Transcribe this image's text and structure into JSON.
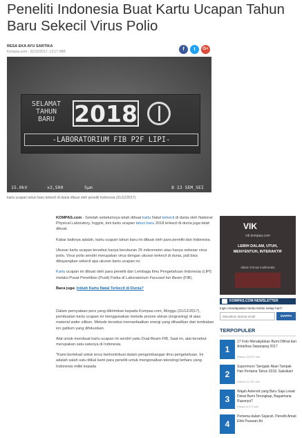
{
  "article": {
    "title": "Peneliti Indonesia Buat Kartu Ucapan Tahun Baru Sekecil Virus Polio",
    "author": "RESA EKA AYU SARTIKA",
    "dateline": "Kompas.com - 31/12/2017, 13:17 WIB",
    "share": {
      "facebook": "f",
      "twitter": "t",
      "googleplus": "G+"
    },
    "photo": {
      "chip_selamat": "SELAMAT\nTAHUN\nBARU",
      "chip_year": "2018",
      "chip_lab": "-LABORATORIUM FIB P2F LIPI-",
      "meta_kv": "15.0kV",
      "meta_mag": "x3,500",
      "meta_scale": "5µm",
      "meta_id": "8 13 SEM_SEI"
    },
    "caption": "kartu ucapan tahun baru terkecil di dunia dibuat oleh peneliti Indonesia (31/12/2017).",
    "paragraphs": [
      {
        "lead": "KOMPAS.com",
        "text_a": " - Setelah sebelumnya telah dibuat ",
        "link_a": "kartu",
        "text_b": " Natal ",
        "link_b": "terkecil",
        "text_c": " di dunia oleh National Physical Laboratory, Inggris, kini kartu ucapan ",
        "link_c": "tahun baru",
        "text_d": " 2018 terkecil di dunia juga telah dibuat."
      },
      {
        "text": "Kabar baiknya adalah, kartu ucapan tahun baru ini dibuat oleh para peneliti dari Indonesia."
      },
      {
        "text": "Ukuran kartu ucapan tersebut hanya berukuran 25 mikrometer atau hanya sebesar virus polio. Virus polio sendiri merupakan virus dengan ukuran terkecil di dunia, jadi bisa dibayangkan sekecil apa ukuran kartu ucapan ini."
      },
      {
        "link": "Kartu",
        "text": " ucapan ini dibuat oleh para peneliti dari Lembaga Ilmu Pengetahuan Indonesia (LIPI) melalui Pusat Penelitian (Pusit) Fisika di Laboratorium ",
        "italic": "Focused Ion Beam",
        "text_b": " (FIB)."
      },
      {
        "label": "Baca juga:",
        "link": "Inikah Kartu Natal Terkecil di Dunia?"
      },
      {
        "text": "Dalam pernyataan pers yang dikirimkan kepada Kompas.com, Minggu (31/12/2017), pembuatan kartu ucapan ini menggunakan metode proses ukiran (engraving) di atas material wafer silikon. Metode tersebut memanfaatkan energi yang dihasilkan dari tembakan ion gallium yang difokuskan."
      },
      {
        "text": "Alat untuk membuat kartu ucapan ini sendiri yaitu Dual-Beam FIB. Saat ini, alat tersebut merupakan satu-satunya di Indonesia."
      },
      {
        "text": "\"Kami bertekad untuk terus berkontribusi dalam pengembangan ilmu pengetahuan. Ini adalah salah satu titikal kami para peneliti untuk mengenalkan teknologi terbaru yang Indonesia miliki kepada"
      }
    ]
  },
  "sidebar": {
    "ad": {
      "brand": "VIK",
      "url": "vik.kompas.com",
      "headline": "LEBIH DALAM, UTUH, MENYENTUH, INTERAKTIF",
      "sub": "dalam format multimedia"
    },
    "newsletter": {
      "header": "KOMPAS.COM NEWSLETTER",
      "text": "Ingin mendapatkan berita terkini setiap hari?",
      "placeholder": "Masukkan alamat email",
      "button": "SIAPPA"
    },
    "popular": {
      "header": "TERPOPULER",
      "items": [
        {
          "num": "1",
          "title": "17 Foto Menakjubkan Bumi Dilihat dari Antariksa Sepanjang 2017",
          "views": "Dibaca 34.097 kali"
        },
        {
          "num": "2",
          "title": "Supermoon 'Serigala' Akan Tampak Hari Pertama Tahun 2018, Saksikan!",
          "views": "Dibaca 11.037 kali"
        },
        {
          "num": "3",
          "title": "Wajah Asteroid yang Baru Saja Lewat Dekat Bumi Terungkap, Bagaimana Rupanya?",
          "views": "Dibaca 8.073 kali"
        },
        {
          "num": "4",
          "title": "Pertama dalam Sejarah, Peneliti Amati Efek Pusaran Air",
          "views": ""
        }
      ]
    }
  }
}
